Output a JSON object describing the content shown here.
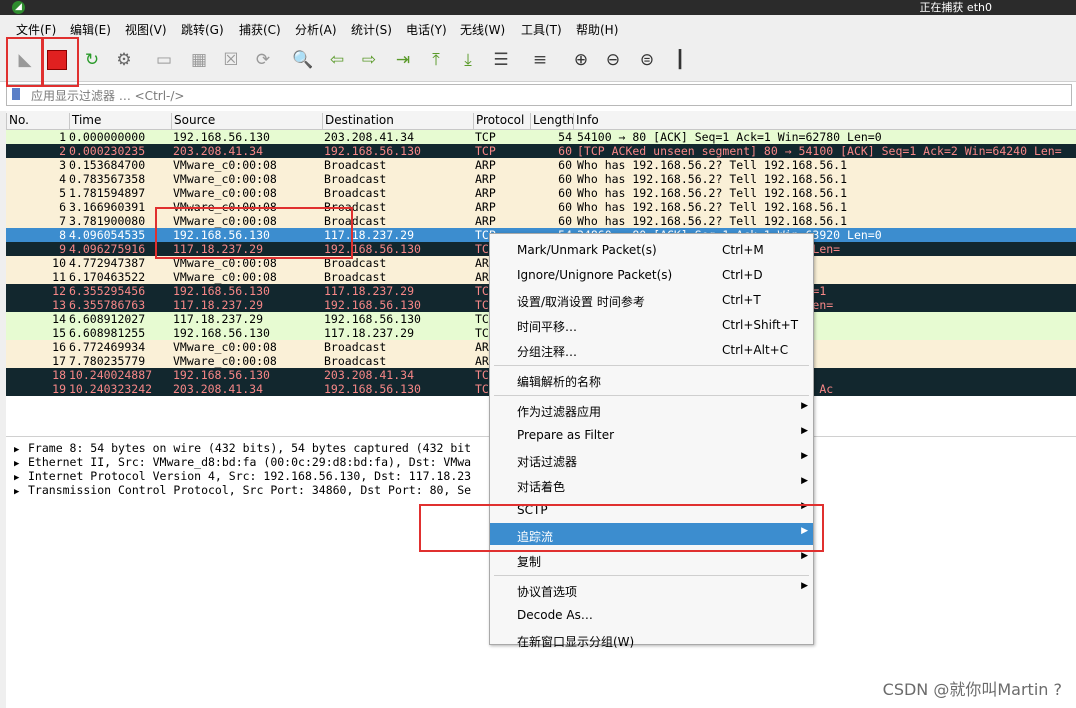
{
  "window": {
    "title": "正在捕获 eth0",
    "app_icon_glyph": "◢"
  },
  "menu": [
    "文件(F)",
    "编辑(E)",
    "视图(V)",
    "跳转(G)",
    "捕获(C)",
    "分析(A)",
    "统计(S)",
    "电话(Y)",
    "无线(W)",
    "工具(T)",
    "帮助(H)"
  ],
  "toolbar_icons": [
    "start-capture-icon",
    "stop-capture-icon",
    "restart-capture-icon",
    "capture-options-icon",
    "open-file-icon",
    "save-file-icon",
    "close-file-icon",
    "reload-file-icon",
    "find-packet-icon",
    "go-back-icon",
    "go-forward-icon",
    "go-to-packet-icon",
    "go-first-icon",
    "go-last-icon",
    "autoscroll-icon",
    "colorize-icon",
    "zoom-in-icon",
    "zoom-out-icon",
    "zoom-normal-icon",
    "resize-columns-icon"
  ],
  "filter": {
    "placeholder": "应用显示过滤器 … <Ctrl-/>"
  },
  "columns": [
    "No.",
    "Time",
    "Source",
    "Destination",
    "Protocol",
    "Length",
    "Info"
  ],
  "colors": {
    "tcp_row": "#e7fbd2",
    "arp_row": "#faf0d7",
    "bad_row_bg": "#12272e",
    "bad_row_fg": "#f78787",
    "selected_row": "#3c8dcf",
    "highlight_box": "#e0302f"
  },
  "packets": [
    {
      "no": "1",
      "time": "0.000000000",
      "src": "192.168.56.130",
      "dst": "203.208.41.34",
      "proto": "TCP",
      "len": "54",
      "info": "54100 → 80 [ACK] Seq=1 Ack=1 Win=62780 Len=0",
      "style": "tcp"
    },
    {
      "no": "2",
      "time": "0.000230235",
      "src": "203.208.41.34",
      "dst": "192.168.56.130",
      "proto": "TCP",
      "len": "60",
      "info": "[TCP ACKed unseen segment] 80 → 54100 [ACK] Seq=1 Ack=2 Win=64240 Len=",
      "style": "bad"
    },
    {
      "no": "3",
      "time": "0.153684700",
      "src": "VMware_c0:00:08",
      "dst": "Broadcast",
      "proto": "ARP",
      "len": "60",
      "info": "Who has 192.168.56.2? Tell 192.168.56.1",
      "style": "arp"
    },
    {
      "no": "4",
      "time": "0.783567358",
      "src": "VMware_c0:00:08",
      "dst": "Broadcast",
      "proto": "ARP",
      "len": "60",
      "info": "Who has 192.168.56.2? Tell 192.168.56.1",
      "style": "arp"
    },
    {
      "no": "5",
      "time": "1.781594897",
      "src": "VMware_c0:00:08",
      "dst": "Broadcast",
      "proto": "ARP",
      "len": "60",
      "info": "Who has 192.168.56.2? Tell 192.168.56.1",
      "style": "arp"
    },
    {
      "no": "6",
      "time": "3.166960391",
      "src": "VMware_c0:00:08",
      "dst": "Broadcast",
      "proto": "ARP",
      "len": "60",
      "info": "Who has 192.168.56.2? Tell 192.168.56.1",
      "style": "arp"
    },
    {
      "no": "7",
      "time": "3.781900080",
      "src": "VMware_c0:00:08",
      "dst": "Broadcast",
      "proto": "ARP",
      "len": "60",
      "info": "Who has 192.168.56.2? Tell 192.168.56.1",
      "style": "arp"
    },
    {
      "no": "8",
      "time": "4.096054535",
      "src": "192.168.56.130",
      "dst": "117.18.237.29",
      "proto": "TCP",
      "len": "54",
      "info": "34860 → 80 [ACK] Seq=1 Ack=1 Win=63920 Len=0",
      "style": "sel"
    },
    {
      "no": "9",
      "time": "4.096275916",
      "src": "117.18.237.29",
      "dst": "192.168.56.130",
      "proto": "TC",
      "len": "",
      "info": "34860 [ACK] Seq=1 Ack=2 Win=64240 Len=",
      "style": "bad"
    },
    {
      "no": "10",
      "time": "4.772947387",
      "src": "VMware_c0:00:08",
      "dst": "Broadcast",
      "proto": "AR",
      "len": "",
      "info": ".56.1",
      "style": "arp"
    },
    {
      "no": "11",
      "time": "6.170463522",
      "src": "VMware_c0:00:08",
      "dst": "Broadcast",
      "proto": "AR",
      "len": "",
      "info": ".56.1",
      "style": "arp"
    },
    {
      "no": "12",
      "time": "6.355295456",
      "src": "192.168.56.130",
      "dst": "117.18.237.29",
      "proto": "TC",
      "len": "",
      "info": "d] 34860 → 80 [FIN, ACK] Seq=2 Ack=1",
      "style": "bad"
    },
    {
      "no": "13",
      "time": "6.355786763",
      "src": "117.18.237.29",
      "dst": "192.168.56.130",
      "proto": "TC",
      "len": "",
      "info": "4860 [ACK] Seq=1 Ack=3 Win=64239 Len=",
      "style": "bad"
    },
    {
      "no": "14",
      "time": "6.608912027",
      "src": "117.18.237.29",
      "dst": "192.168.56.130",
      "proto": "TC",
      "len": "",
      "info": "Ack=3 Win=64239 Len=0",
      "style": "tcp"
    },
    {
      "no": "15",
      "time": "6.608981255",
      "src": "192.168.56.130",
      "dst": "117.18.237.29",
      "proto": "TC",
      "len": "",
      "info": "63920 Len=0",
      "style": "tcp"
    },
    {
      "no": "16",
      "time": "6.772469934",
      "src": "VMware_c0:00:08",
      "dst": "Broadcast",
      "proto": "AR",
      "len": "",
      "info": ".56.1",
      "style": "arp"
    },
    {
      "no": "17",
      "time": "7.780235779",
      "src": "VMware_c0:00:08",
      "dst": "Broadcast",
      "proto": "AR",
      "len": "",
      "info": ".56.1",
      "style": "arp"
    },
    {
      "no": "18",
      "time": "10.240024887",
      "src": "192.168.56.130",
      "dst": "203.208.41.34",
      "proto": "TC",
      "len": "",
      "info": "] Seq=1 Ack=1 Win=62780 Len=0",
      "style": "bad"
    },
    {
      "no": "19",
      "time": "10.240323242",
      "src": "203.208.41.34",
      "dst": "192.168.56.130",
      "proto": "TC",
      "len": "",
      "info": "en segment] 80 → 54100 [ACK] Seq=1 Ac",
      "style": "bad"
    }
  ],
  "details": [
    "Frame 8: 54 bytes on wire (432 bits), 54 bytes captured (432 bit",
    "Ethernet II, Src: VMware_d8:bd:fa (00:0c:29:d8:bd:fa), Dst: VMwa",
    "Internet Protocol Version 4, Src: 192.168.56.130, Dst: 117.18.23",
    "Transmission Control Protocol, Src Port: 34860, Dst Port: 80, Se"
  ],
  "context_menu": [
    {
      "label": "Mark/Unmark Packet(s)",
      "shortcut": "Ctrl+M",
      "submenu": false
    },
    {
      "label": "Ignore/Unignore Packet(s)",
      "shortcut": "Ctrl+D",
      "submenu": false
    },
    {
      "label": "设置/取消设置 时间参考",
      "shortcut": "Ctrl+T",
      "submenu": false
    },
    {
      "label": "时间平移…",
      "shortcut": "Ctrl+Shift+T",
      "submenu": false
    },
    {
      "label": "分组注释…",
      "shortcut": "Ctrl+Alt+C",
      "submenu": false
    },
    {
      "separator": true
    },
    {
      "label": "编辑解析的名称",
      "shortcut": "",
      "submenu": false
    },
    {
      "separator": true
    },
    {
      "label": "作为过滤器应用",
      "shortcut": "",
      "submenu": true
    },
    {
      "label": "Prepare as Filter",
      "shortcut": "",
      "submenu": true
    },
    {
      "label": "对话过滤器",
      "shortcut": "",
      "submenu": true
    },
    {
      "label": "对话着色",
      "shortcut": "",
      "submenu": true
    },
    {
      "label": "SCTP",
      "shortcut": "",
      "submenu": true
    },
    {
      "label": "追踪流",
      "shortcut": "",
      "submenu": true,
      "highlighted": true
    },
    {
      "label": "复制",
      "shortcut": "",
      "submenu": true
    },
    {
      "separator": true
    },
    {
      "label": "协议首选项",
      "shortcut": "",
      "submenu": true
    },
    {
      "label": "Decode As…",
      "shortcut": "",
      "submenu": false
    },
    {
      "label": "在新窗口显示分组(W)",
      "shortcut": "",
      "submenu": false
    }
  ],
  "watermark": "CSDN @就你叫Martin ?"
}
